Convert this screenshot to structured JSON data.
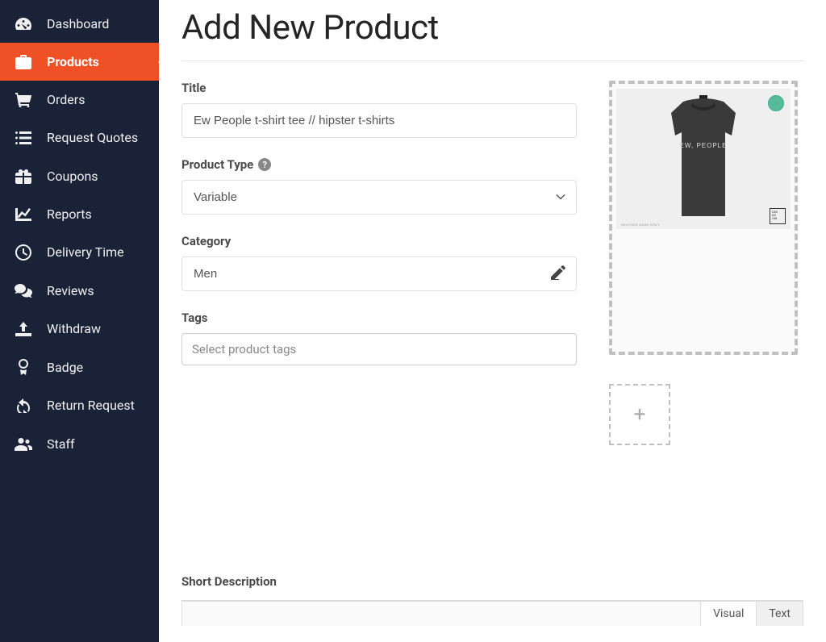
{
  "sidebar": {
    "items": [
      {
        "label": "Dashboard"
      },
      {
        "label": "Products"
      },
      {
        "label": "Orders"
      },
      {
        "label": "Request Quotes"
      },
      {
        "label": "Coupons"
      },
      {
        "label": "Reports"
      },
      {
        "label": "Delivery Time"
      },
      {
        "label": "Reviews"
      },
      {
        "label": "Withdraw"
      },
      {
        "label": "Badge"
      },
      {
        "label": "Return Request"
      },
      {
        "label": "Staff"
      }
    ]
  },
  "page": {
    "title": "Add New Product"
  },
  "form": {
    "title_label": "Title",
    "title_value": "Ew People t-shirt tee // hipster t-shirts",
    "product_type_label": "Product Type",
    "product_type_value": "Variable",
    "category_label": "Category",
    "category_value": "Men",
    "tags_label": "Tags",
    "tags_placeholder": "Select product tags",
    "short_desc_label": "Short Description"
  },
  "editor": {
    "tab_visual": "Visual",
    "tab_text": "Text"
  },
  "product_image": {
    "text": "EW, PEOPLE",
    "caption": "HEATHER DARK GREY"
  }
}
